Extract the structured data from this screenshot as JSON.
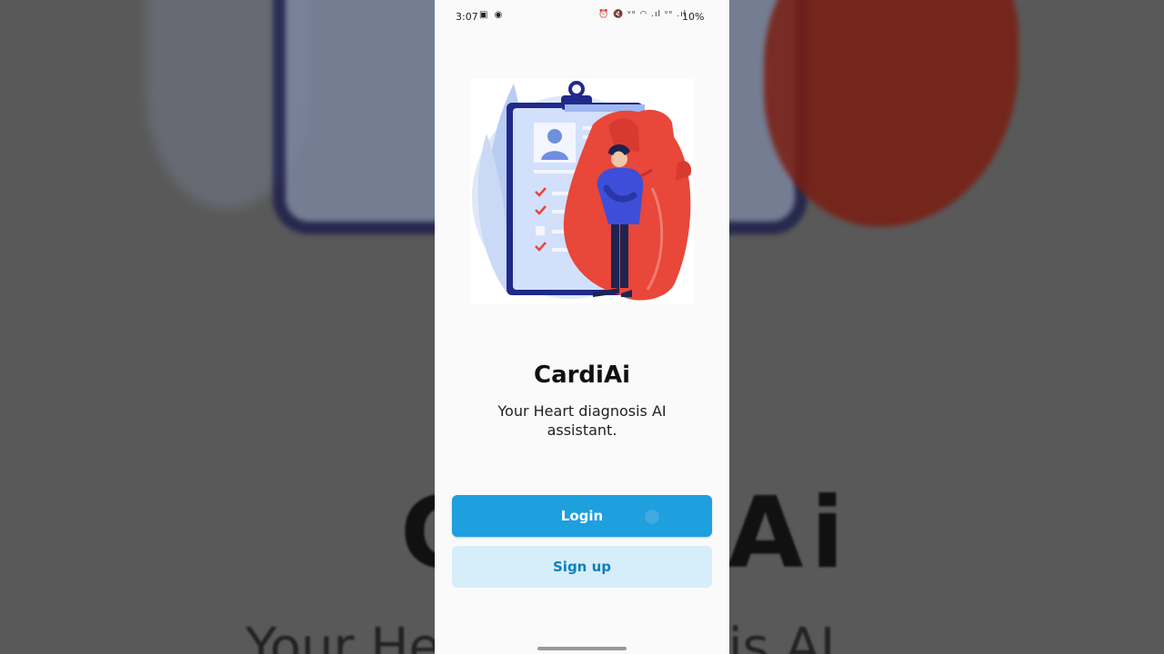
{
  "status_bar": {
    "time": "3:07",
    "left_icons": "▣ ◉",
    "right_icons": "⏰ 🔇 ᵛᵒ ◠ .ıl ᵛᵒ .ıl",
    "battery": "10%"
  },
  "app": {
    "title": "CardiAi",
    "subtitle": "Your Heart diagnosis AI assistant."
  },
  "buttons": {
    "login": "Login",
    "signup": "Sign up"
  },
  "background": {
    "title": "CardiAi",
    "subtitle": "Your Heart diagnosis AI"
  },
  "colors": {
    "primary": "#1e9fde",
    "secondary_bg": "#d5eefa",
    "secondary_text": "#0e7fb8",
    "heart": "#e8473a",
    "clipboard": "#1f2a8a"
  },
  "illustration": {
    "icons": [
      "clipboard-icon",
      "heart-icon",
      "person-icon",
      "checkmark-icon"
    ]
  }
}
